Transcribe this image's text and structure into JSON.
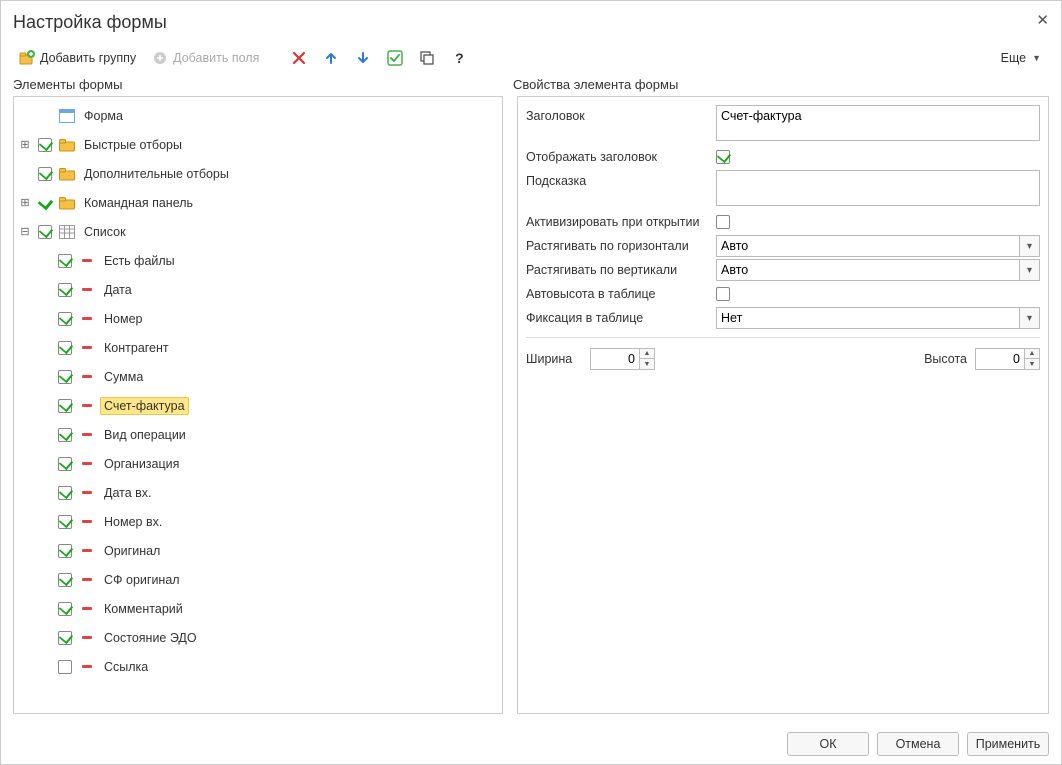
{
  "title": "Настройка формы",
  "toolbar": {
    "add_group": "Добавить группу",
    "add_fields": "Добавить поля",
    "more": "Еще"
  },
  "sections": {
    "left": "Элементы формы",
    "right": "Свойства элемента формы"
  },
  "tree": {
    "root": "Форма",
    "quick_filters": "Быстрые отборы",
    "additional_filters": "Дополнительные отборы",
    "command_panel": "Командная панель",
    "list": "Список",
    "list_items": [
      {
        "label": "Есть файлы",
        "checked": true
      },
      {
        "label": "Дата",
        "checked": true
      },
      {
        "label": "Номер",
        "checked": true
      },
      {
        "label": "Контрагент",
        "checked": true
      },
      {
        "label": "Сумма",
        "checked": true
      },
      {
        "label": "Счет-фактура",
        "checked": true,
        "selected": true
      },
      {
        "label": "Вид операции",
        "checked": true
      },
      {
        "label": "Организация",
        "checked": true
      },
      {
        "label": "Дата вх.",
        "checked": true
      },
      {
        "label": "Номер вх.",
        "checked": true
      },
      {
        "label": "Оригинал",
        "checked": true
      },
      {
        "label": "СФ оригинал",
        "checked": true
      },
      {
        "label": "Комментарий",
        "checked": true
      },
      {
        "label": "Состояние ЭДО",
        "checked": true
      },
      {
        "label": "Ссылка",
        "checked": false
      }
    ]
  },
  "props": {
    "labels": {
      "title": "Заголовок",
      "show_title": "Отображать заголовок",
      "hint": "Подсказка",
      "activate_on_open": "Активизировать при открытии",
      "stretch_h": "Растягивать по горизонтали",
      "stretch_v": "Растягивать по вертикали",
      "auto_height": "Автовысота в таблице",
      "fixation": "Фиксация в таблице",
      "width": "Ширина",
      "height": "Высота"
    },
    "values": {
      "title": "Счет-фактура",
      "show_title": true,
      "hint": "",
      "activate_on_open": false,
      "stretch_h": "Авто",
      "stretch_v": "Авто",
      "auto_height": false,
      "fixation": "Нет",
      "width": "0",
      "height": "0"
    }
  },
  "footer": {
    "ok": "ОК",
    "cancel": "Отмена",
    "apply": "Применить"
  }
}
